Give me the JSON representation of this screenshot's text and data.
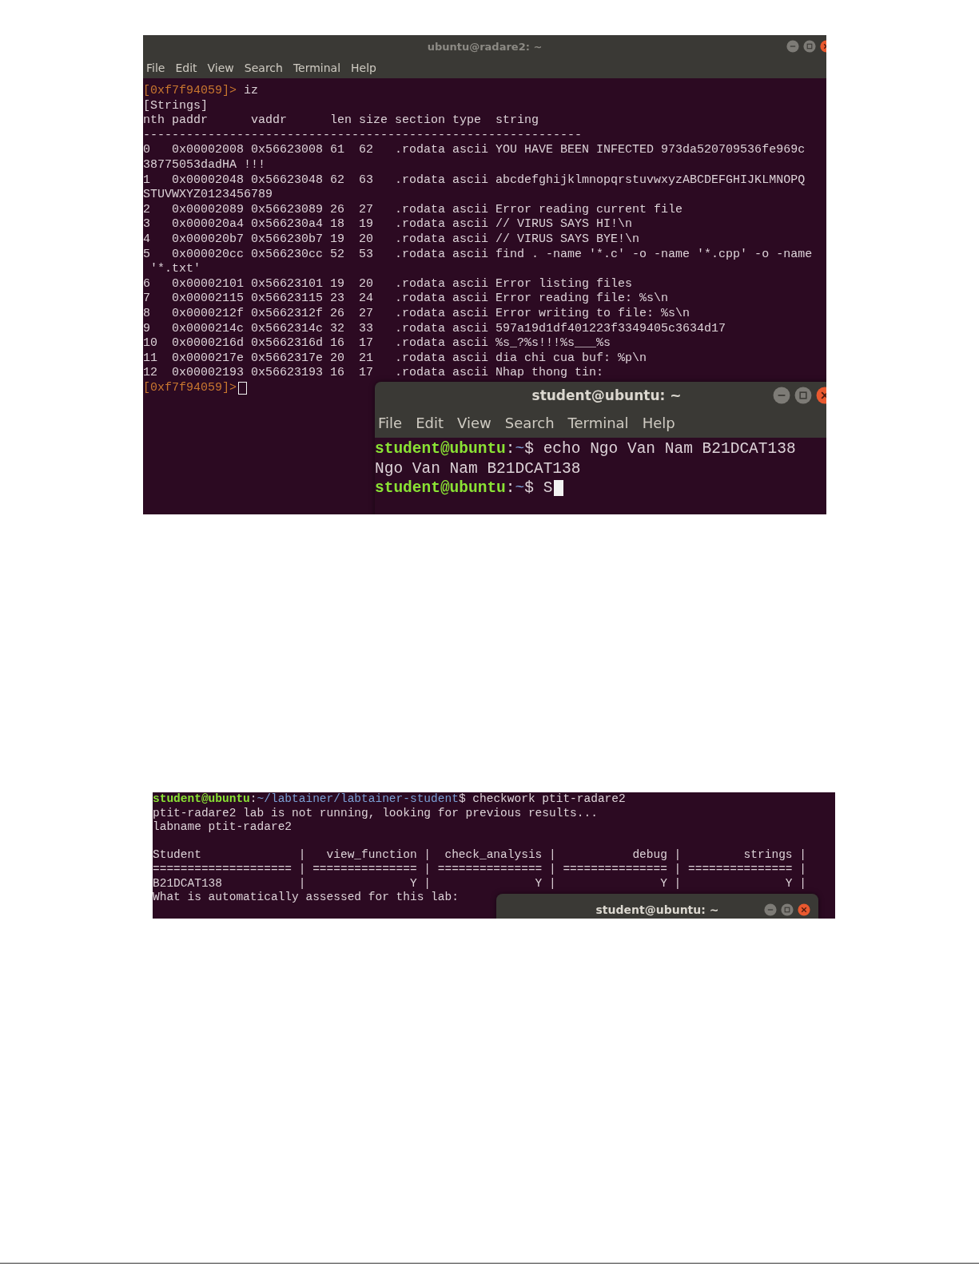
{
  "radare_terminal": {
    "title": "ubuntu@radare2: ~",
    "menu": [
      "File",
      "Edit",
      "View",
      "Search",
      "Terminal",
      "Help"
    ],
    "lines": [
      {
        "kind": "r2",
        "prompt": "[0xf7f94059]>",
        "command": " iz",
        "cursor": false
      },
      {
        "kind": "output",
        "text": "[Strings]"
      },
      {
        "kind": "output",
        "text": "nth paddr      vaddr      len size section type  string"
      },
      {
        "kind": "output",
        "text": "-------------------------------------------------------------"
      },
      {
        "kind": "output",
        "text": "0   0x00002008 0x56623008 61  62   .rodata ascii YOU HAVE BEEN INFECTED 973da520709536fe969c"
      },
      {
        "kind": "output",
        "text": "38775053dadHA !!!"
      },
      {
        "kind": "output",
        "text": "1   0x00002048 0x56623048 62  63   .rodata ascii abcdefghijklmnopqrstuvwxyzABCDEFGHIJKLMNOPQ"
      },
      {
        "kind": "output",
        "text": "STUVWXYZ0123456789"
      },
      {
        "kind": "output",
        "text": "2   0x00002089 0x56623089 26  27   .rodata ascii Error reading current file"
      },
      {
        "kind": "output",
        "text": "3   0x000020a4 0x566230a4 18  19   .rodata ascii // VIRUS SAYS HI!\\n"
      },
      {
        "kind": "output",
        "text": "4   0x000020b7 0x566230b7 19  20   .rodata ascii // VIRUS SAYS BYE!\\n"
      },
      {
        "kind": "output",
        "text": "5   0x000020cc 0x566230cc 52  53   .rodata ascii find . -name '*.c' -o -name '*.cpp' -o -name"
      },
      {
        "kind": "output",
        "text": " '*.txt'"
      },
      {
        "kind": "output",
        "text": "6   0x00002101 0x56623101 19  20   .rodata ascii Error listing files"
      },
      {
        "kind": "output",
        "text": "7   0x00002115 0x56623115 23  24   .rodata ascii Error reading file: %s\\n"
      },
      {
        "kind": "output",
        "text": "8   0x0000212f 0x5662312f 26  27   .rodata ascii Error writing to file: %s\\n"
      },
      {
        "kind": "output",
        "text": "9   0x0000214c 0x5662314c 32  33   .rodata ascii 597a19d1df401223f3349405c3634d17"
      },
      {
        "kind": "output",
        "text": "10  0x0000216d 0x5662316d 16  17   .rodata ascii %s_?%s!!!%s___%s"
      },
      {
        "kind": "output",
        "text": "11  0x0000217e 0x5662317e 20  21   .rodata ascii dia chi cua buf: %p\\n"
      },
      {
        "kind": "output",
        "text": "12  0x00002193 0x56623193 16  17   .rodata ascii Nhap thong tin:"
      },
      {
        "kind": "r2",
        "prompt": "[0xf7f94059]>",
        "cursor": true
      }
    ]
  },
  "student_terminal": {
    "title": "student@ubuntu: ~",
    "menu": [
      "File",
      "Edit",
      "View",
      "Search",
      "Terminal",
      "Help"
    ],
    "lines": [
      {
        "kind": "shell",
        "user": "student@ubuntu",
        "separator": ":",
        "path": "~",
        "command": "$ echo Ngo Van Nam B21DCAT138",
        "cursor": false
      },
      {
        "kind": "output",
        "text": "Ngo Van Nam B21DCAT138"
      },
      {
        "kind": "shell",
        "user": "student@ubuntu",
        "separator": ":",
        "path": "~",
        "command": "$ S",
        "cursor": true
      }
    ]
  },
  "checkwork_terminal": {
    "lines": [
      {
        "kind": "shell",
        "user": "student@ubuntu",
        "separator": ":",
        "path": "~/labtainer/labtainer-student",
        "command": "$ checkwork ptit-radare2",
        "cursor": false
      },
      {
        "kind": "output",
        "text": "ptit-radare2 lab is not running, looking for previous results..."
      },
      {
        "kind": "output",
        "text": "labname ptit-radare2"
      },
      {
        "kind": "blank"
      },
      {
        "kind": "output",
        "text": "Student              |   view_function |  check_analysis |           debug |         strings |"
      },
      {
        "kind": "output",
        "text": "==================== | =============== | =============== | =============== | =============== |"
      },
      {
        "kind": "output",
        "text": "B21DCAT138           |               Y |               Y |               Y |               Y |"
      },
      {
        "kind": "output",
        "text": "What is automatically assessed for this lab:"
      }
    ],
    "overlay_window": {
      "title": "student@ubuntu: ~"
    }
  }
}
